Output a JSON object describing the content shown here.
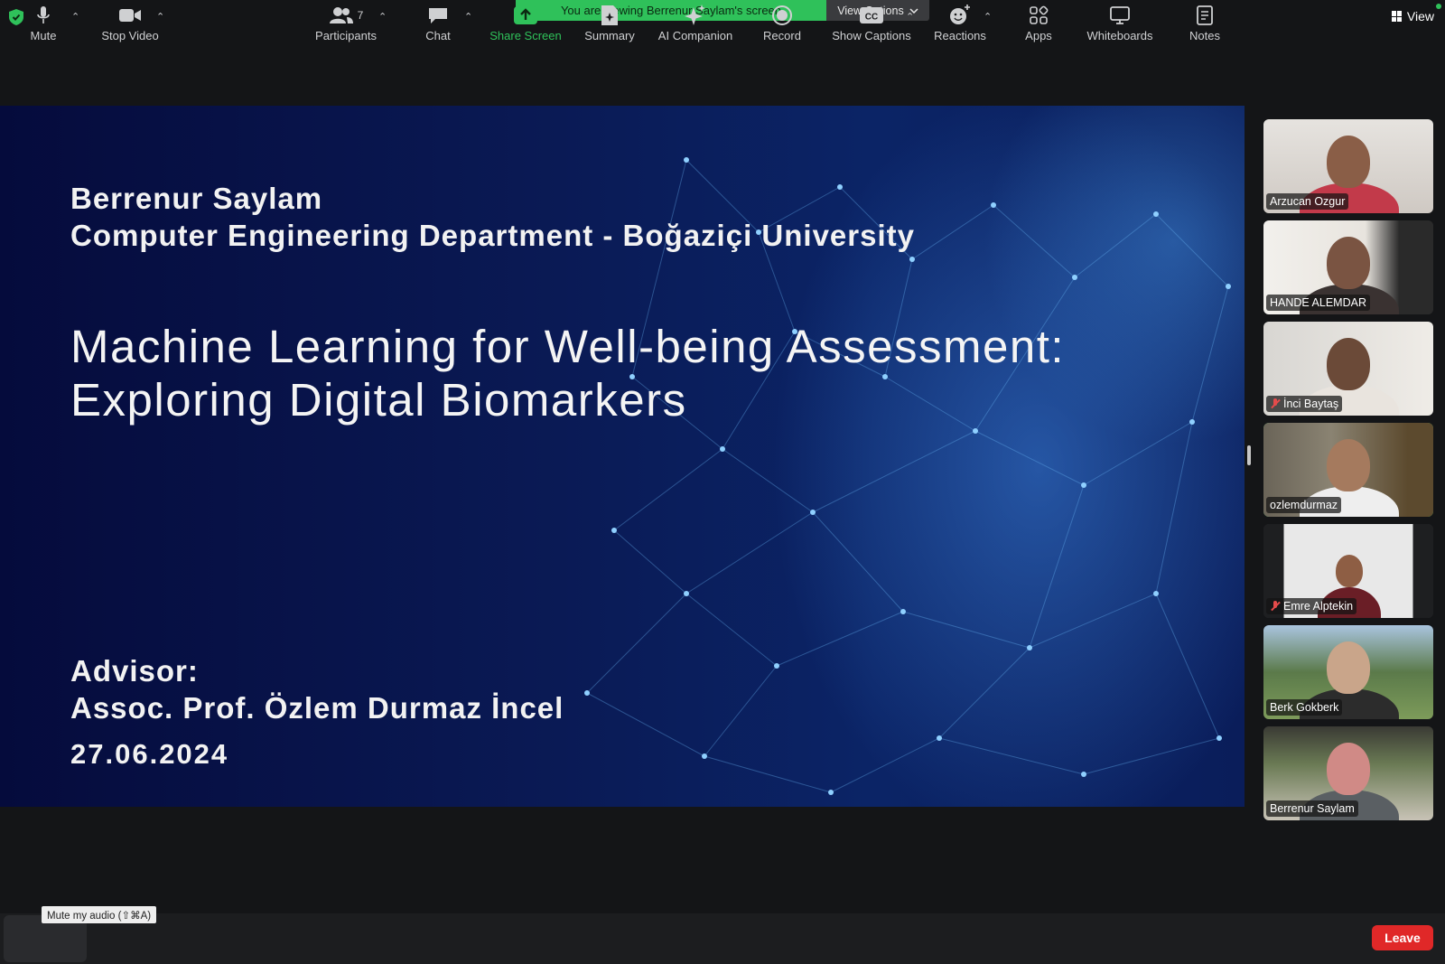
{
  "banner": {
    "viewing_text": "You are viewing Berrenur Saylam's screen",
    "view_options_label": "View Options"
  },
  "view_button_label": "View",
  "slide": {
    "author": "Berrenur Saylam",
    "department": "Computer Engineering Department - Boğaziçi University",
    "title_line1": "Machine Learning for Well-being Assessment:",
    "title_line2": "Exploring Digital Biomarkers",
    "advisor_label": "Advisor:",
    "advisor_name": "Assoc. Prof. Özlem Durmaz İncel",
    "date": "27.06.2024"
  },
  "participants": [
    {
      "name": "Arzucan Ozgur",
      "muted": false
    },
    {
      "name": "HANDE ALEMDAR",
      "muted": false
    },
    {
      "name": "İnci Baytaş",
      "muted": true
    },
    {
      "name": "ozlemdurmaz",
      "muted": false,
      "active_speaker": true
    },
    {
      "name": "Emre Alptekin",
      "muted": true
    },
    {
      "name": "Berk Gokberk",
      "muted": false
    },
    {
      "name": "Berrenur Saylam",
      "muted": false
    }
  ],
  "toolbar": {
    "tooltip": "Mute my audio (⇧⌘A)",
    "mute": "Mute",
    "stop_video": "Stop Video",
    "participants": "Participants",
    "participants_count": "7",
    "chat": "Chat",
    "share_screen": "Share Screen",
    "summary": "Summary",
    "ai_companion": "AI Companion",
    "record": "Record",
    "show_captions": "Show Captions",
    "reactions": "Reactions",
    "apps": "Apps",
    "whiteboards": "Whiteboards",
    "notes": "Notes",
    "leave": "Leave"
  },
  "colors": {
    "accent_green": "#2fc15a",
    "leave_red": "#e02828",
    "slide_bg": "#0a1a55"
  }
}
